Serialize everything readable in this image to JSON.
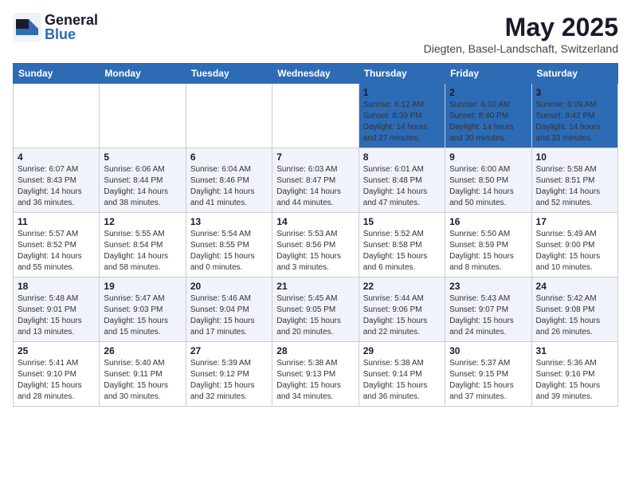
{
  "logo": {
    "general": "General",
    "blue": "Blue"
  },
  "title": "May 2025",
  "subtitle": "Diegten, Basel-Landschaft, Switzerland",
  "days_of_week": [
    "Sunday",
    "Monday",
    "Tuesday",
    "Wednesday",
    "Thursday",
    "Friday",
    "Saturday"
  ],
  "weeks": [
    [
      {
        "day": "",
        "info": ""
      },
      {
        "day": "",
        "info": ""
      },
      {
        "day": "",
        "info": ""
      },
      {
        "day": "",
        "info": ""
      },
      {
        "day": "1",
        "info": "Sunrise: 6:12 AM\nSunset: 8:39 PM\nDaylight: 14 hours\nand 27 minutes."
      },
      {
        "day": "2",
        "info": "Sunrise: 6:10 AM\nSunset: 8:40 PM\nDaylight: 14 hours\nand 30 minutes."
      },
      {
        "day": "3",
        "info": "Sunrise: 6:09 AM\nSunset: 8:42 PM\nDaylight: 14 hours\nand 33 minutes."
      }
    ],
    [
      {
        "day": "4",
        "info": "Sunrise: 6:07 AM\nSunset: 8:43 PM\nDaylight: 14 hours\nand 36 minutes."
      },
      {
        "day": "5",
        "info": "Sunrise: 6:06 AM\nSunset: 8:44 PM\nDaylight: 14 hours\nand 38 minutes."
      },
      {
        "day": "6",
        "info": "Sunrise: 6:04 AM\nSunset: 8:46 PM\nDaylight: 14 hours\nand 41 minutes."
      },
      {
        "day": "7",
        "info": "Sunrise: 6:03 AM\nSunset: 8:47 PM\nDaylight: 14 hours\nand 44 minutes."
      },
      {
        "day": "8",
        "info": "Sunrise: 6:01 AM\nSunset: 8:48 PM\nDaylight: 14 hours\nand 47 minutes."
      },
      {
        "day": "9",
        "info": "Sunrise: 6:00 AM\nSunset: 8:50 PM\nDaylight: 14 hours\nand 50 minutes."
      },
      {
        "day": "10",
        "info": "Sunrise: 5:58 AM\nSunset: 8:51 PM\nDaylight: 14 hours\nand 52 minutes."
      }
    ],
    [
      {
        "day": "11",
        "info": "Sunrise: 5:57 AM\nSunset: 8:52 PM\nDaylight: 14 hours\nand 55 minutes."
      },
      {
        "day": "12",
        "info": "Sunrise: 5:55 AM\nSunset: 8:54 PM\nDaylight: 14 hours\nand 58 minutes."
      },
      {
        "day": "13",
        "info": "Sunrise: 5:54 AM\nSunset: 8:55 PM\nDaylight: 15 hours\nand 0 minutes."
      },
      {
        "day": "14",
        "info": "Sunrise: 5:53 AM\nSunset: 8:56 PM\nDaylight: 15 hours\nand 3 minutes."
      },
      {
        "day": "15",
        "info": "Sunrise: 5:52 AM\nSunset: 8:58 PM\nDaylight: 15 hours\nand 6 minutes."
      },
      {
        "day": "16",
        "info": "Sunrise: 5:50 AM\nSunset: 8:59 PM\nDaylight: 15 hours\nand 8 minutes."
      },
      {
        "day": "17",
        "info": "Sunrise: 5:49 AM\nSunset: 9:00 PM\nDaylight: 15 hours\nand 10 minutes."
      }
    ],
    [
      {
        "day": "18",
        "info": "Sunrise: 5:48 AM\nSunset: 9:01 PM\nDaylight: 15 hours\nand 13 minutes."
      },
      {
        "day": "19",
        "info": "Sunrise: 5:47 AM\nSunset: 9:03 PM\nDaylight: 15 hours\nand 15 minutes."
      },
      {
        "day": "20",
        "info": "Sunrise: 5:46 AM\nSunset: 9:04 PM\nDaylight: 15 hours\nand 17 minutes."
      },
      {
        "day": "21",
        "info": "Sunrise: 5:45 AM\nSunset: 9:05 PM\nDaylight: 15 hours\nand 20 minutes."
      },
      {
        "day": "22",
        "info": "Sunrise: 5:44 AM\nSunset: 9:06 PM\nDaylight: 15 hours\nand 22 minutes."
      },
      {
        "day": "23",
        "info": "Sunrise: 5:43 AM\nSunset: 9:07 PM\nDaylight: 15 hours\nand 24 minutes."
      },
      {
        "day": "24",
        "info": "Sunrise: 5:42 AM\nSunset: 9:08 PM\nDaylight: 15 hours\nand 26 minutes."
      }
    ],
    [
      {
        "day": "25",
        "info": "Sunrise: 5:41 AM\nSunset: 9:10 PM\nDaylight: 15 hours\nand 28 minutes."
      },
      {
        "day": "26",
        "info": "Sunrise: 5:40 AM\nSunset: 9:11 PM\nDaylight: 15 hours\nand 30 minutes."
      },
      {
        "day": "27",
        "info": "Sunrise: 5:39 AM\nSunset: 9:12 PM\nDaylight: 15 hours\nand 32 minutes."
      },
      {
        "day": "28",
        "info": "Sunrise: 5:38 AM\nSunset: 9:13 PM\nDaylight: 15 hours\nand 34 minutes."
      },
      {
        "day": "29",
        "info": "Sunrise: 5:38 AM\nSunset: 9:14 PM\nDaylight: 15 hours\nand 36 minutes."
      },
      {
        "day": "30",
        "info": "Sunrise: 5:37 AM\nSunset: 9:15 PM\nDaylight: 15 hours\nand 37 minutes."
      },
      {
        "day": "31",
        "info": "Sunrise: 5:36 AM\nSunset: 9:16 PM\nDaylight: 15 hours\nand 39 minutes."
      }
    ]
  ]
}
